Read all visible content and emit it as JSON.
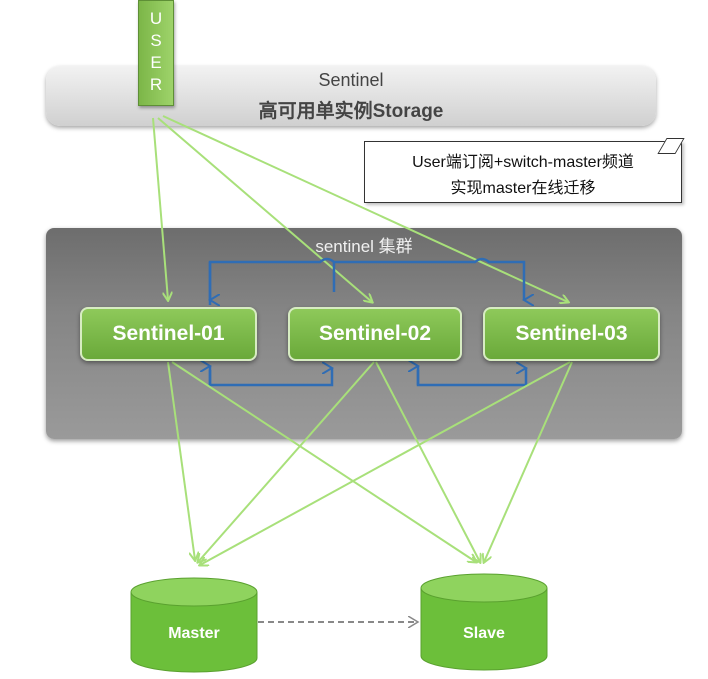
{
  "storage": {
    "title": "Sentinel",
    "subtitle": "高可用单实例Storage"
  },
  "user": {
    "letters": [
      "U",
      "S",
      "E",
      "R"
    ]
  },
  "note": {
    "line1": "User端订阅+switch-master频道",
    "line2": "实现master在线迁移"
  },
  "cluster": {
    "title": "sentinel 集群",
    "nodes": [
      {
        "label": "Sentinel-01"
      },
      {
        "label": "Sentinel-02"
      },
      {
        "label": "Sentinel-03"
      }
    ]
  },
  "databases": {
    "master": "Master",
    "slave": "Slave"
  },
  "colors": {
    "green_line": "#a8e07a",
    "blue_line": "#2f6db5",
    "node_green": "#7cb648",
    "db_green": "#6cbf3a"
  }
}
